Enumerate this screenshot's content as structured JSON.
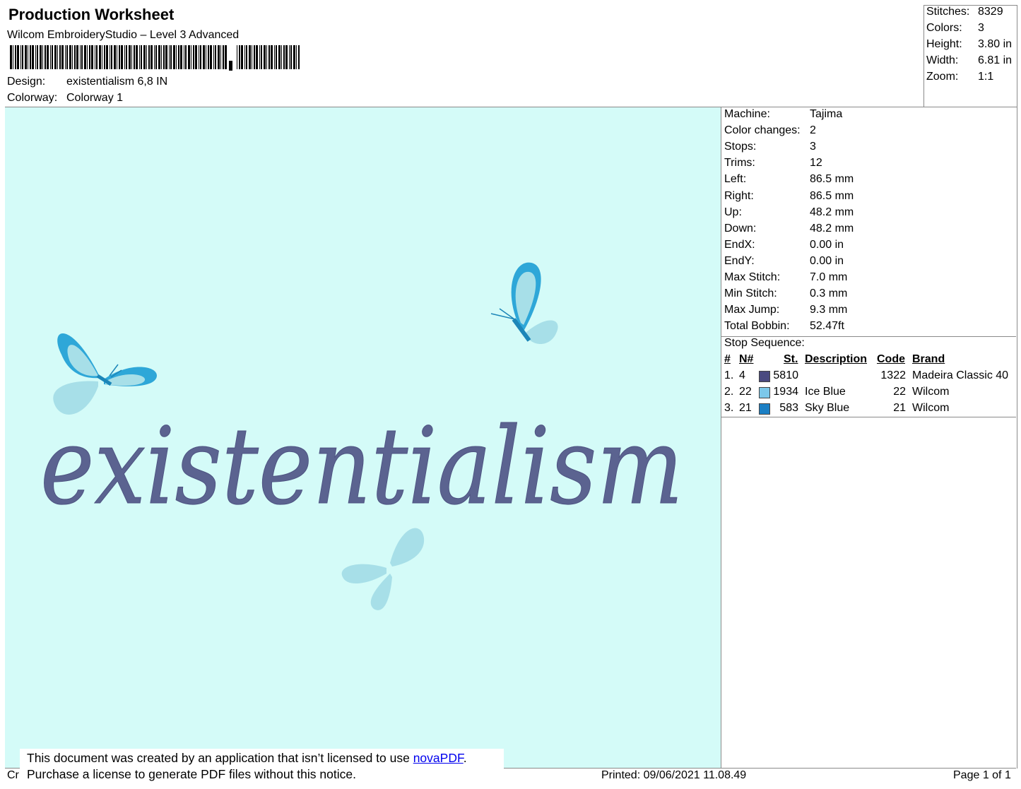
{
  "header": {
    "title": "Production Worksheet",
    "software": "Wilcom EmbroideryStudio – Level 3 Advanced",
    "design_label": "Design:",
    "design_value": "existentialism 6,8 IN",
    "colorway_label": "Colorway:",
    "colorway_value": "Colorway 1"
  },
  "summary": [
    {
      "label": "Stitches:",
      "value": "8329"
    },
    {
      "label": "Colors:",
      "value": "3"
    },
    {
      "label": "Height:",
      "value": "3.80 in"
    },
    {
      "label": "Width:",
      "value": "6.81 in"
    },
    {
      "label": "Zoom:",
      "value": "1:1"
    }
  ],
  "machine_info": [
    {
      "label": "Machine:",
      "value": "Tajima"
    },
    {
      "label": "Color changes:",
      "value": "2"
    },
    {
      "label": "Stops:",
      "value": "3"
    },
    {
      "label": "Trims:",
      "value": "12"
    },
    {
      "label": "Left:",
      "value": "86.5 mm"
    },
    {
      "label": "Right:",
      "value": "86.5 mm"
    },
    {
      "label": "Up:",
      "value": "48.2 mm"
    },
    {
      "label": "Down:",
      "value": "48.2 mm"
    },
    {
      "label": "EndX:",
      "value": "0.00 in"
    },
    {
      "label": "EndY:",
      "value": "0.00 in"
    },
    {
      "label": "Max Stitch:",
      "value": "7.0 mm"
    },
    {
      "label": "Min Stitch:",
      "value": "0.3 mm"
    },
    {
      "label": "Max Jump:",
      "value": "9.3 mm"
    },
    {
      "label": "Total Bobbin:",
      "value": "52.47ft"
    }
  ],
  "stop_sequence": {
    "title": "Stop Sequence:",
    "headers": {
      "num": "#",
      "n": "N#",
      "st": "St.",
      "desc": "Description",
      "code": "Code",
      "brand": "Brand"
    },
    "rows": [
      {
        "num": "1.",
        "n": "4",
        "color": "#4a4a80",
        "st": "5810",
        "desc": "",
        "code": "1322",
        "brand": "Madeira Classic 40"
      },
      {
        "num": "2.",
        "n": "22",
        "color": "#7cc8ea",
        "st": "1934",
        "desc": "Ice Blue",
        "code": "22",
        "brand": "Wilcom"
      },
      {
        "num": "3.",
        "n": "21",
        "color": "#1b7fc4",
        "st": "583",
        "desc": "Sky Blue",
        "code": "21",
        "brand": "Wilcom"
      }
    ]
  },
  "design_preview": {
    "text": "existentialism",
    "thread_color": "#5b6390",
    "background": "#d4fbf8"
  },
  "footer": {
    "notice_line1": "This document was created by an application that isn’t licensed to use ",
    "notice_link": "novaPDF",
    "notice_line1_end": ".",
    "notice_line2": "Purchase a license to generate PDF files without this notice.",
    "partial_left": "Cr",
    "printed": "Printed: 09/06/2021 11.08.49",
    "page": "Page 1 of 1"
  }
}
